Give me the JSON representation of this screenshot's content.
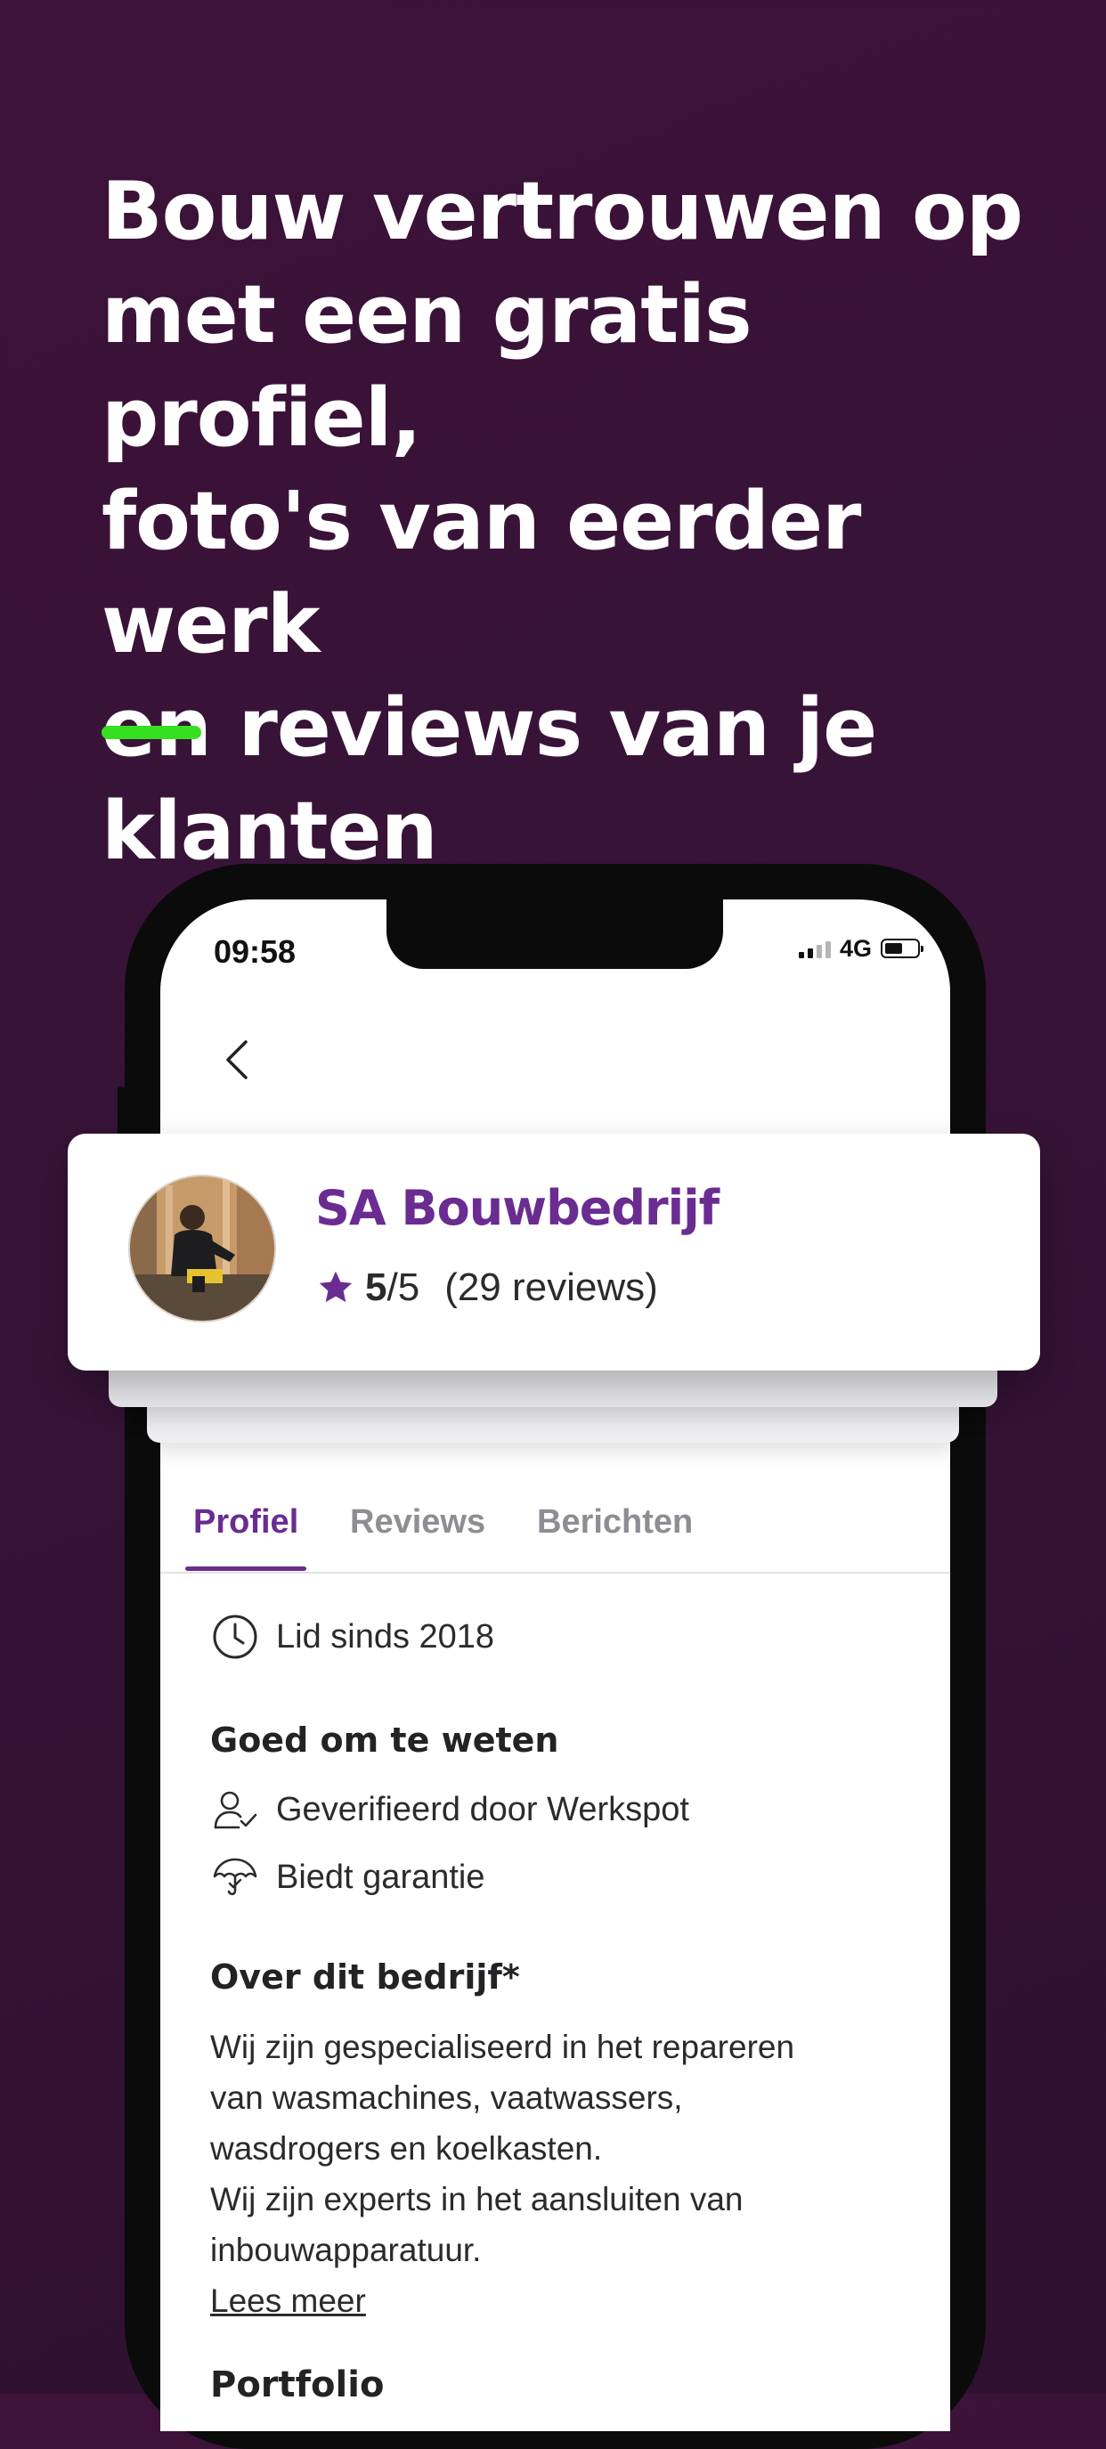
{
  "headline": {
    "line1": "Bouw vertrouwen op",
    "line2": "met een gratis profiel,",
    "line3": "foto's van eerder werk",
    "line4": "en reviews van je",
    "line5": "klanten"
  },
  "colors": {
    "background": "#361337",
    "accent_green": "#34e01f",
    "brand_purple": "#6a2c91"
  },
  "status_bar": {
    "time": "09:58",
    "network": "4G"
  },
  "profile": {
    "company_name": "SA Bouwbedrijf",
    "rating_value": "5",
    "rating_max": "/5",
    "reviews_text": "(29 reviews)"
  },
  "tabs": [
    {
      "label": "Profiel",
      "active": true
    },
    {
      "label": "Reviews",
      "active": false
    },
    {
      "label": "Berichten",
      "active": false
    }
  ],
  "member_since": "Lid sinds 2018",
  "good_to_know": {
    "title": "Goed om te weten",
    "items": [
      {
        "icon": "verified-user-icon",
        "label": "Geverifieerd door Werkspot"
      },
      {
        "icon": "umbrella-icon",
        "label": "Biedt garantie"
      }
    ]
  },
  "about": {
    "title": "Over dit bedrijf*",
    "line1": "Wij zijn gespecialiseerd in het repareren",
    "line2": "van wasmachines, vaatwassers,",
    "line3": "wasdrogers en koelkasten.",
    "line4": "Wij zijn experts in het aansluiten van",
    "line5": "inbouwapparatuur.",
    "read_more": "Lees meer"
  },
  "portfolio_title": "Portfolio"
}
